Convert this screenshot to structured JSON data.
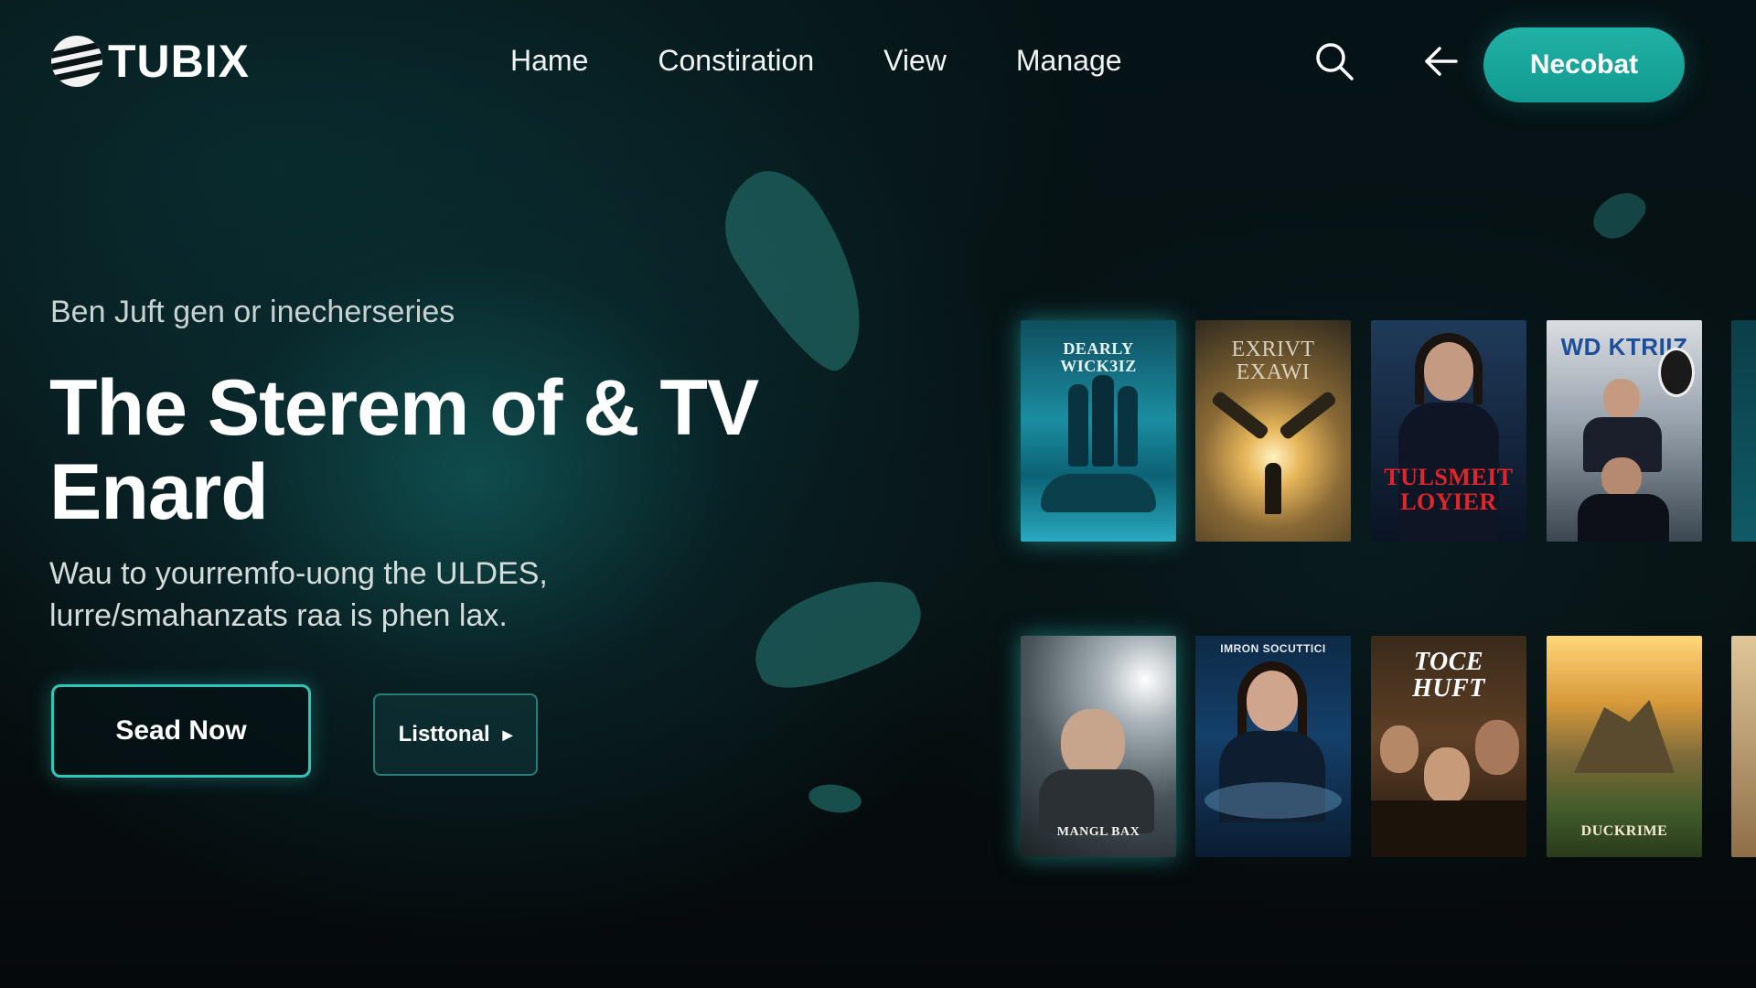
{
  "app": {
    "logo_text": "TUBIX"
  },
  "nav": {
    "items": [
      {
        "label": "Hame"
      },
      {
        "label": "Constiration"
      },
      {
        "label": "View"
      },
      {
        "label": "Manage"
      }
    ],
    "icons": [
      "search-icon",
      "back-arrow-icon"
    ],
    "cta_label": "Necobat"
  },
  "hero": {
    "eyebrow": "Ben Juft gen or inecherseries",
    "title_line1": "The Sterem of & TV",
    "title_line2": "Enard",
    "description_line1": "Wau to yourremfo-uong the ULDES,",
    "description_line2": "lurre/smahanzats raa is phen lax.",
    "primary_button": "Sead Now",
    "secondary_button": "Listtonal"
  },
  "posters": {
    "row1": [
      {
        "title": "DEARLY WICK3IZ"
      },
      {
        "title": "EXRIVT EXAWI"
      },
      {
        "title": "TULSMEIT LOYIER"
      },
      {
        "title": "WD KTRIIZ"
      }
    ],
    "row2": [
      {
        "title": "MANGL BAX"
      },
      {
        "title": "IMRON SOCUTTICI"
      },
      {
        "title": "TOCE HUFT"
      },
      {
        "title": "DUCKRIME"
      }
    ]
  },
  "colors": {
    "accent": "#22b1a6",
    "background": "#070b0d",
    "glow": "#2fc6ba"
  }
}
